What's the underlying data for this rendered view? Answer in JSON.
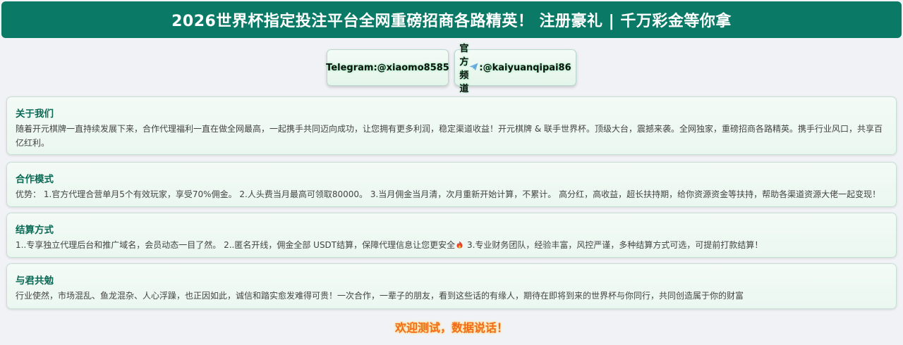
{
  "banner": {
    "title": "2026世界杯指定投注平台全网重磅招商各路精英！ 注册豪礼 | 千万彩金等你拿"
  },
  "contacts": {
    "telegram": "Telegram:@xiaomo8585",
    "channel_prefix": "官方频道",
    "channel_handle": ":@kaiyuanqipai86",
    "plane_icon": "paper-plane-icon"
  },
  "sections": {
    "about": {
      "title": "关于我们",
      "body": "随着开元棋牌一直持续发展下来，合作代理福利一直在做全网最高，一起携手共同迈向成功，让您拥有更多利润，稳定渠道收益！开元棋牌 & 联手世界杯。顶级大台，震撼来袭。全网独家，重磅招商各路精英。携手行业风口，共享百亿红利。"
    },
    "mode": {
      "title": "合作模式",
      "body": "优势： 1.官方代理合营单月5个有效玩家，享受70%佣金。 2.人头费当月最高可领取80000。 3.当月佣金当月清，次月重新开始计算，不累计。 高分红，高收益，超长扶持期，给你资源资金等扶持，帮助各渠道资源大佬一起变现！"
    },
    "settle": {
      "title": "结算方式",
      "body_before": "1..专享独立代理后台和推广域名，会员动态一目了然。 2..匿名开线，佣金全部 USDT结算，保障代理信息让您更安全",
      "body_after": " 3.专业财务团队，经验丰富，风控严谨，多种结算方式可选，可提前打款结算！",
      "fire_icon": "fire-icon"
    },
    "together": {
      "title": "与君共勉",
      "body": "行业使然，市场混乱、鱼龙混杂、人心浮躁，也正因如此，诚信和踏实愈发难得可贵！一次合作，一辈子的朋友，看到这些话的有缘人，期待在即将到来的世界杯与你同行，共同创造属于你的财富"
    }
  },
  "footer": {
    "slogan": "欢迎测试，数据说话！"
  },
  "colors": {
    "banner": "#0a7a67",
    "heading": "#0a6a56",
    "slogan": "#f26a1b",
    "background": "#f1f2f6"
  }
}
